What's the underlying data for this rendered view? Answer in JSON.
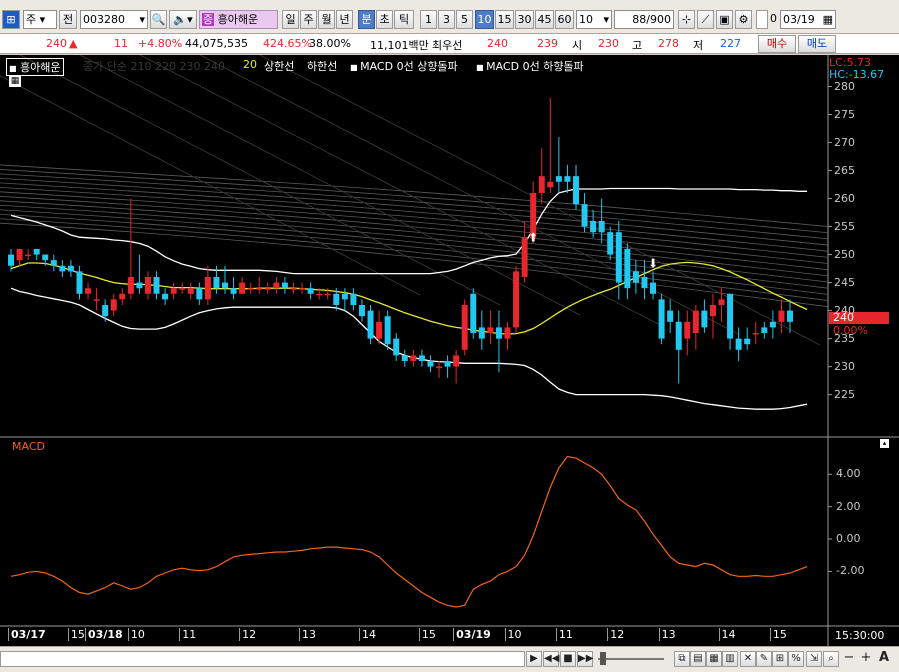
{
  "toolbar": {
    "period_select": "주",
    "mode_button": "전",
    "code_value": "003280",
    "stock_name": "흥아해운",
    "stock_badge": "증",
    "interval_buttons": [
      "일",
      "주",
      "월",
      "년",
      "분",
      "초",
      "틱"
    ],
    "active_interval": "분",
    "minute_buttons": [
      "1",
      "3",
      "5",
      "10",
      "15",
      "30",
      "45",
      "60"
    ],
    "active_minute": "10",
    "count_value": "10",
    "page_value": "88",
    "page_total": "/900",
    "checkbox_label": "0",
    "date_value": "03/19"
  },
  "quote": {
    "price": "240",
    "change_arrow": "▲",
    "change": "11",
    "change_rate": "+4.80%",
    "volume": "44,075,535",
    "volume_ratio": "424.65%",
    "turnover": "38.00%",
    "amount": "11,101백만",
    "ask_label": "최우선",
    "best_ask": "240",
    "best_bid": "239",
    "open_label": "시",
    "open": "230",
    "high_label": "고",
    "high": "278",
    "low_label": "저",
    "low": "227",
    "buy_button": "매수",
    "sell_button": "매도"
  },
  "price_pane": {
    "legend_name": "흥아해운",
    "legend_ma": "종가 단순 210 220 230 240",
    "legend_20": "20",
    "legend_upper": "상한선",
    "legend_lower": "하한선",
    "legend_macd_up": "MACD 0선 상향돌파",
    "legend_macd_down": "MACD 0선 하향돌파",
    "lc_label": "LC:5.73",
    "hc_label": "HC:-13.67",
    "current_price": "240",
    "current_change": "0.00%",
    "y_ticks": [
      "280",
      "275",
      "270",
      "265",
      "260",
      "255",
      "250",
      "245",
      "240",
      "235",
      "230",
      "225"
    ],
    "colors": {
      "up": "#e8262e",
      "down": "#23c8f0",
      "ma20": "#e8e82e",
      "band": "#ffffff"
    }
  },
  "macd_pane": {
    "label": "MACD",
    "y_ticks": [
      "4.00",
      "2.00",
      "0.00",
      "-2.00"
    ],
    "line_color": "#f06418"
  },
  "x_axis": {
    "labels": [
      "03/17",
      "15",
      "03/18",
      "10",
      "11",
      "12",
      "13",
      "14",
      "15",
      "03/19",
      "10",
      "11",
      "12",
      "13",
      "14",
      "15"
    ],
    "time": "15:30:00"
  },
  "chart_data": {
    "type": "candlestick",
    "y_range": [
      220,
      280
    ],
    "candles": [
      {
        "o": 250,
        "h": 251,
        "l": 247,
        "c": 248
      },
      {
        "o": 249,
        "h": 251,
        "l": 248,
        "c": 251
      },
      {
        "o": 250,
        "h": 251,
        "l": 249,
        "c": 250
      },
      {
        "o": 251,
        "h": 251,
        "l": 249,
        "c": 250
      },
      {
        "o": 250,
        "h": 250,
        "l": 248,
        "c": 249
      },
      {
        "o": 249,
        "h": 250,
        "l": 247,
        "c": 248
      },
      {
        "o": 248,
        "h": 249,
        "l": 246,
        "c": 247
      },
      {
        "o": 248,
        "h": 249,
        "l": 246,
        "c": 247
      },
      {
        "o": 247,
        "h": 248,
        "l": 242,
        "c": 243
      },
      {
        "o": 243,
        "h": 245,
        "l": 242,
        "c": 244
      },
      {
        "o": 242,
        "h": 244,
        "l": 240,
        "c": 242
      },
      {
        "o": 241,
        "h": 242,
        "l": 238,
        "c": 239
      },
      {
        "o": 240,
        "h": 243,
        "l": 239,
        "c": 242
      },
      {
        "o": 242,
        "h": 244,
        "l": 241,
        "c": 243
      },
      {
        "o": 243,
        "h": 260,
        "l": 242,
        "c": 246
      },
      {
        "o": 245,
        "h": 250,
        "l": 243,
        "c": 244
      },
      {
        "o": 243,
        "h": 247,
        "l": 242,
        "c": 246
      },
      {
        "o": 246,
        "h": 247,
        "l": 242,
        "c": 243
      },
      {
        "o": 243,
        "h": 244,
        "l": 241,
        "c": 242
      },
      {
        "o": 243,
        "h": 245,
        "l": 242,
        "c": 244
      },
      {
        "o": 244,
        "h": 245,
        "l": 243,
        "c": 244
      },
      {
        "o": 243,
        "h": 245,
        "l": 242,
        "c": 244
      },
      {
        "o": 244,
        "h": 245,
        "l": 241,
        "c": 242
      },
      {
        "o": 242,
        "h": 248,
        "l": 241,
        "c": 246
      },
      {
        "o": 246,
        "h": 248,
        "l": 243,
        "c": 244
      },
      {
        "o": 245,
        "h": 248,
        "l": 243,
        "c": 244
      },
      {
        "o": 244,
        "h": 246,
        "l": 242,
        "c": 243
      },
      {
        "o": 243,
        "h": 246,
        "l": 243,
        "c": 245
      },
      {
        "o": 244,
        "h": 245,
        "l": 243,
        "c": 244
      },
      {
        "o": 244,
        "h": 246,
        "l": 243,
        "c": 244
      },
      {
        "o": 244,
        "h": 245,
        "l": 243,
        "c": 244
      },
      {
        "o": 244,
        "h": 246,
        "l": 243,
        "c": 245
      },
      {
        "o": 245,
        "h": 246,
        "l": 243,
        "c": 244
      },
      {
        "o": 244,
        "h": 245,
        "l": 243,
        "c": 244
      },
      {
        "o": 244,
        "h": 245,
        "l": 243,
        "c": 244
      },
      {
        "o": 244,
        "h": 245,
        "l": 242,
        "c": 243
      },
      {
        "o": 243,
        "h": 244,
        "l": 242,
        "c": 243
      },
      {
        "o": 243,
        "h": 244,
        "l": 242,
        "c": 243
      },
      {
        "o": 243,
        "h": 244,
        "l": 240,
        "c": 241
      },
      {
        "o": 243,
        "h": 244,
        "l": 240,
        "c": 242
      },
      {
        "o": 243,
        "h": 244,
        "l": 240,
        "c": 241
      },
      {
        "o": 241,
        "h": 242,
        "l": 238,
        "c": 239
      },
      {
        "o": 240,
        "h": 241,
        "l": 234,
        "c": 235
      },
      {
        "o": 235,
        "h": 240,
        "l": 234,
        "c": 238
      },
      {
        "o": 239,
        "h": 240,
        "l": 233,
        "c": 234
      },
      {
        "o": 235,
        "h": 236,
        "l": 231,
        "c": 232
      },
      {
        "o": 232,
        "h": 233,
        "l": 230,
        "c": 231
      },
      {
        "o": 231,
        "h": 233,
        "l": 230,
        "c": 232
      },
      {
        "o": 232,
        "h": 233,
        "l": 230,
        "c": 231
      },
      {
        "o": 231,
        "h": 232,
        "l": 229,
        "c": 230
      },
      {
        "o": 230,
        "h": 231,
        "l": 228,
        "c": 230
      },
      {
        "o": 231,
        "h": 232,
        "l": 228,
        "c": 230
      },
      {
        "o": 230,
        "h": 233,
        "l": 227,
        "c": 232
      },
      {
        "o": 233,
        "h": 242,
        "l": 232,
        "c": 241
      },
      {
        "o": 243,
        "h": 244,
        "l": 235,
        "c": 236
      },
      {
        "o": 237,
        "h": 240,
        "l": 233,
        "c": 235
      },
      {
        "o": 236,
        "h": 240,
        "l": 234,
        "c": 237
      },
      {
        "o": 237,
        "h": 240,
        "l": 229,
        "c": 235
      },
      {
        "o": 235,
        "h": 238,
        "l": 233,
        "c": 237
      },
      {
        "o": 237,
        "h": 248,
        "l": 236,
        "c": 247
      },
      {
        "o": 246,
        "h": 256,
        "l": 245,
        "c": 253
      },
      {
        "o": 253,
        "h": 263,
        "l": 252,
        "c": 261
      },
      {
        "o": 261,
        "h": 269,
        "l": 259,
        "c": 264
      },
      {
        "o": 262,
        "h": 278,
        "l": 261,
        "c": 263
      },
      {
        "o": 264,
        "h": 271,
        "l": 261,
        "c": 263
      },
      {
        "o": 264,
        "h": 266,
        "l": 261,
        "c": 263
      },
      {
        "o": 264,
        "h": 266,
        "l": 258,
        "c": 259
      },
      {
        "o": 259,
        "h": 261,
        "l": 254,
        "c": 255
      },
      {
        "o": 256,
        "h": 258,
        "l": 253,
        "c": 254
      },
      {
        "o": 256,
        "h": 260,
        "l": 252,
        "c": 254
      },
      {
        "o": 254,
        "h": 255,
        "l": 249,
        "c": 250
      },
      {
        "o": 254,
        "h": 256,
        "l": 242,
        "c": 245
      },
      {
        "o": 251,
        "h": 252,
        "l": 242,
        "c": 244
      },
      {
        "o": 247,
        "h": 249,
        "l": 243,
        "c": 245
      },
      {
        "o": 246,
        "h": 249,
        "l": 242,
        "c": 244
      },
      {
        "o": 245,
        "h": 247,
        "l": 242,
        "c": 243
      },
      {
        "o": 242,
        "h": 243,
        "l": 234,
        "c": 235
      },
      {
        "o": 240,
        "h": 242,
        "l": 236,
        "c": 238
      },
      {
        "o": 238,
        "h": 240,
        "l": 227,
        "c": 233
      },
      {
        "o": 235,
        "h": 240,
        "l": 232,
        "c": 238
      },
      {
        "o": 236,
        "h": 241,
        "l": 233,
        "c": 240
      },
      {
        "o": 240,
        "h": 242,
        "l": 236,
        "c": 237
      },
      {
        "o": 239,
        "h": 243,
        "l": 235,
        "c": 241
      },
      {
        "o": 241,
        "h": 244,
        "l": 238,
        "c": 242
      },
      {
        "o": 243,
        "h": 243,
        "l": 233,
        "c": 235
      },
      {
        "o": 235,
        "h": 237,
        "l": 231,
        "c": 233
      },
      {
        "o": 235,
        "h": 237,
        "l": 233,
        "c": 234
      },
      {
        "o": 236,
        "h": 238,
        "l": 234,
        "c": 236
      },
      {
        "o": 237,
        "h": 238,
        "l": 235,
        "c": 236
      },
      {
        "o": 238,
        "h": 240,
        "l": 235,
        "c": 237
      },
      {
        "o": 238,
        "h": 242,
        "l": 236,
        "c": 240
      },
      {
        "o": 240,
        "h": 242,
        "l": 236,
        "c": 238
      }
    ],
    "ma20": [
      247.5,
      248,
      248.5,
      248.5,
      248.4,
      248.1,
      247.7,
      247.2,
      246.7,
      246.3,
      245.9,
      245.4,
      245,
      244.8,
      244.7,
      244.7,
      244.6,
      244.5,
      244.3,
      244.1,
      244.1,
      244.1,
      244,
      243.9,
      243.9,
      243.9,
      243.9,
      243.9,
      243.9,
      244,
      244,
      244,
      244,
      244,
      243.9,
      243.8,
      243.7,
      243.6,
      243.4,
      243.2,
      242.9,
      242.5,
      241.9,
      241.4,
      240.8,
      240.2,
      239.6,
      239.1,
      238.6,
      238.1,
      237.7,
      237.3,
      237,
      236.8,
      236.5,
      236.3,
      236.1,
      235.9,
      235.8,
      235.9,
      236.2,
      236.8,
      237.7,
      238.7,
      239.7,
      240.6,
      241.4,
      242.1,
      242.7,
      243.3,
      243.8,
      244.5,
      245.2,
      245.9,
      246.6,
      247.3,
      247.9,
      248.3,
      248.5,
      248.6,
      248.5,
      248.3,
      248.0,
      247.5,
      246.9,
      246.2,
      245.5,
      244.7,
      243.9,
      243.1,
      242.4,
      241.6,
      240.9,
      240.2
    ],
    "upper_band": [
      257,
      256.6,
      256.2,
      255.8,
      255.3,
      254.8,
      254.2,
      253.5,
      253.1,
      253.0,
      252.9,
      252.8,
      252.6,
      252.5,
      252.3,
      252.0,
      251.5,
      250.6,
      249.6,
      248.9,
      248.3,
      247.9,
      247.5,
      247.3,
      247.2,
      247.2,
      247.2,
      247.2,
      247.2,
      247.2,
      247.1,
      247.0,
      246.8,
      246.6,
      246.6,
      246.6,
      246.6,
      246.6,
      246.6,
      246.6,
      246.6,
      246.6,
      246.6,
      246.6,
      246.6,
      246.6,
      246.6,
      246.6,
      246.6,
      246.6,
      246.8,
      247,
      247.4,
      248.0,
      248.6,
      249.0,
      249.4,
      249.7,
      249.8,
      250.1,
      252,
      254.5,
      257.2,
      259.5,
      261,
      261.4,
      261.7,
      261.7,
      261.7,
      261.7,
      261.8,
      261.8,
      261.8,
      261.8,
      261.8,
      261.8,
      261.8,
      261.8,
      261.7,
      261.7,
      261.7,
      261.7,
      261.7,
      261.7,
      261.7,
      261.6,
      261.6,
      261.6,
      261.5,
      261.5,
      261.4,
      261.4,
      261.3,
      261.3
    ],
    "lower_band": [
      244,
      243.4,
      243.1,
      242.7,
      242.4,
      242.1,
      241.8,
      241.5,
      241.0,
      240.2,
      239.4,
      238.6,
      237.9,
      237.2,
      236.8,
      236.7,
      236.7,
      236.7,
      237,
      237.6,
      238.3,
      239.0,
      239.6,
      240.0,
      240.3,
      240.5,
      240.6,
      240.6,
      240.6,
      240.6,
      240.6,
      240.6,
      240.6,
      240.6,
      240.6,
      240.6,
      240.6,
      240.6,
      240.5,
      240,
      239,
      237.5,
      236,
      234.5,
      233.5,
      232.6,
      232.0,
      231.6,
      231.3,
      231.0,
      230.9,
      230.8,
      230.7,
      230.6,
      230.6,
      230.6,
      230.6,
      230.6,
      230.5,
      230.4,
      230.2,
      229.5,
      228.5,
      227.2,
      226,
      225.4,
      225,
      225,
      225,
      225,
      225,
      225,
      225,
      225,
      225,
      224.9,
      224.8,
      224.6,
      224.3,
      224.0,
      223.7,
      223.4,
      223.2,
      223.0,
      222.8,
      222.6,
      222.5,
      222.4,
      222.4,
      222.4,
      222.5,
      222.7,
      223.0,
      223.3
    ],
    "macd": [
      -2.3,
      -2.2,
      -2.05,
      -2.0,
      -2.1,
      -2.3,
      -2.6,
      -3.0,
      -3.3,
      -3.4,
      -3.2,
      -3.0,
      -2.7,
      -2.9,
      -3.1,
      -3.0,
      -2.7,
      -2.3,
      -2.1,
      -1.9,
      -1.8,
      -1.9,
      -1.95,
      -1.9,
      -1.7,
      -1.4,
      -1.1,
      -1.0,
      -0.95,
      -0.9,
      -0.85,
      -0.8,
      -0.8,
      -0.75,
      -0.7,
      -0.6,
      -0.55,
      -0.5,
      -0.5,
      -0.55,
      -0.6,
      -0.65,
      -0.8,
      -1.1,
      -1.6,
      -2.1,
      -2.5,
      -2.9,
      -3.3,
      -3.6,
      -3.9,
      -4.1,
      -4.2,
      -4.1,
      -3.1,
      -2.8,
      -2.6,
      -2.2,
      -2.0,
      -1.7,
      -1.0,
      0.2,
      1.7,
      3.2,
      4.4,
      5.1,
      5.0,
      4.7,
      4.4,
      4.0,
      3.3,
      2.5,
      2.1,
      1.8,
      1.1,
      0.3,
      -0.4,
      -1.1,
      -1.5,
      -1.6,
      -1.7,
      -1.5,
      -1.6,
      -1.9,
      -2.2,
      -2.3,
      -2.3,
      -2.25,
      -2.3,
      -2.3,
      -2.2,
      -2.1,
      -1.9,
      -1.7
    ],
    "macd_range": [
      -5,
      5.5
    ],
    "signal_arrows": [
      {
        "index": 61,
        "dir": "up"
      },
      {
        "index": 75,
        "dir": "down"
      }
    ]
  },
  "bottom": {
    "scroll_buttons": [
      "◀",
      "▶",
      "◀◀",
      "■",
      "▶▶"
    ],
    "zoom_minus": "−",
    "zoom_plus": "+",
    "font_letter": "A"
  }
}
